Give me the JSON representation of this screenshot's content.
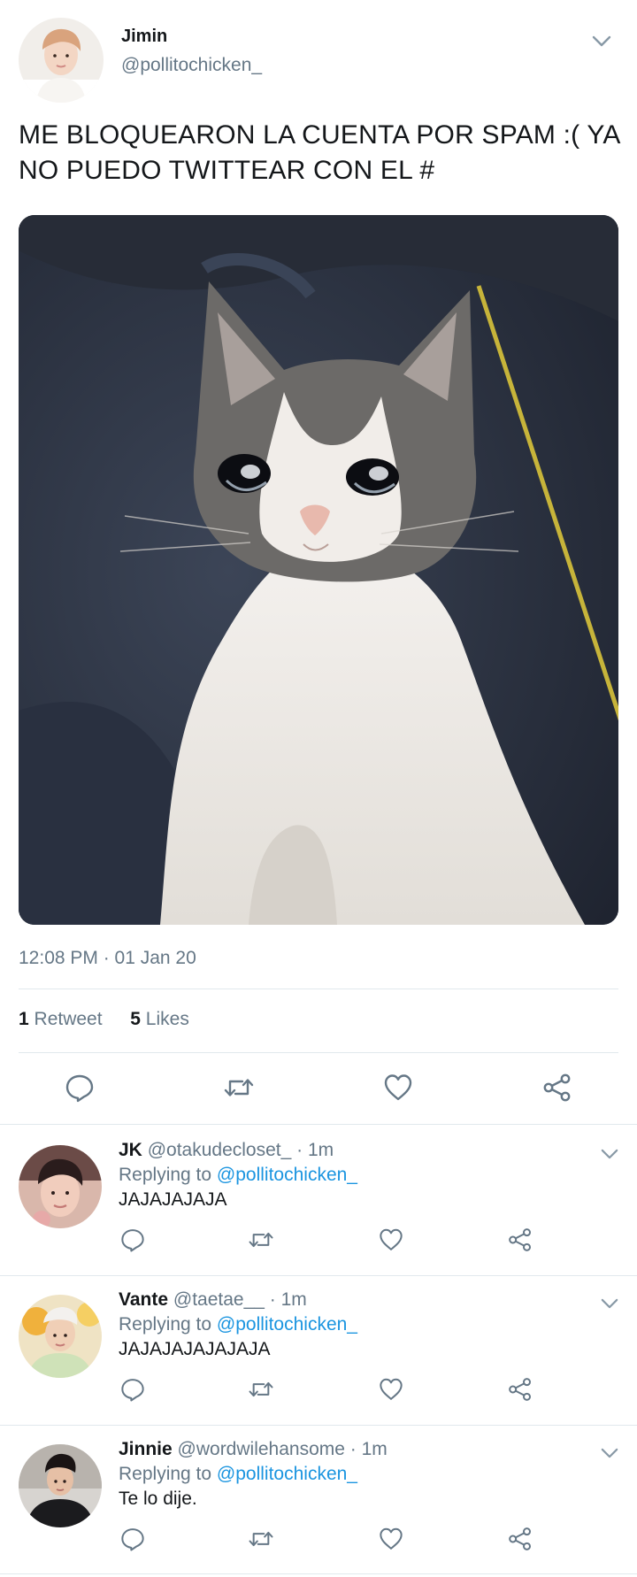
{
  "tweet": {
    "author_name": "Jimin",
    "author_handle": "@pollitochicken_",
    "text": "ME BLOQUEARON LA CUENTA POR SPAM :( YA NO PUEDO TWITTEAR CON EL #",
    "timestamp": "12:08 PM · 01 Jan 20",
    "retweet_count": "1",
    "retweet_label": "Retweet",
    "like_count": "5",
    "like_label": "Likes"
  },
  "replies": [
    {
      "name": "JK",
      "meta": "@otakudecloset_ · 1m",
      "replying_prefix": "Replying to",
      "replying_to": "@pollitochicken_",
      "text": "JAJAJAJAJA"
    },
    {
      "name": "Vante",
      "meta": "@taetae__ · 1m",
      "replying_prefix": "Replying to",
      "replying_to": "@pollitochicken_",
      "text": "JAJAJAJAJAJAJA"
    },
    {
      "name": "Jinnie",
      "meta": "@wordwilehansome · 1m",
      "replying_prefix": "Replying to",
      "replying_to": "@pollitochicken_",
      "text": "Te lo dije."
    }
  ],
  "icons": {
    "reply": "reply-icon",
    "retweet": "retweet-icon",
    "like": "heart-icon",
    "share": "share-icon",
    "menu": "chevron-down-icon"
  },
  "colors": {
    "text": "#14171a",
    "secondary": "#657786",
    "mention": "#1b95e0",
    "divider": "#e1e8ed"
  }
}
